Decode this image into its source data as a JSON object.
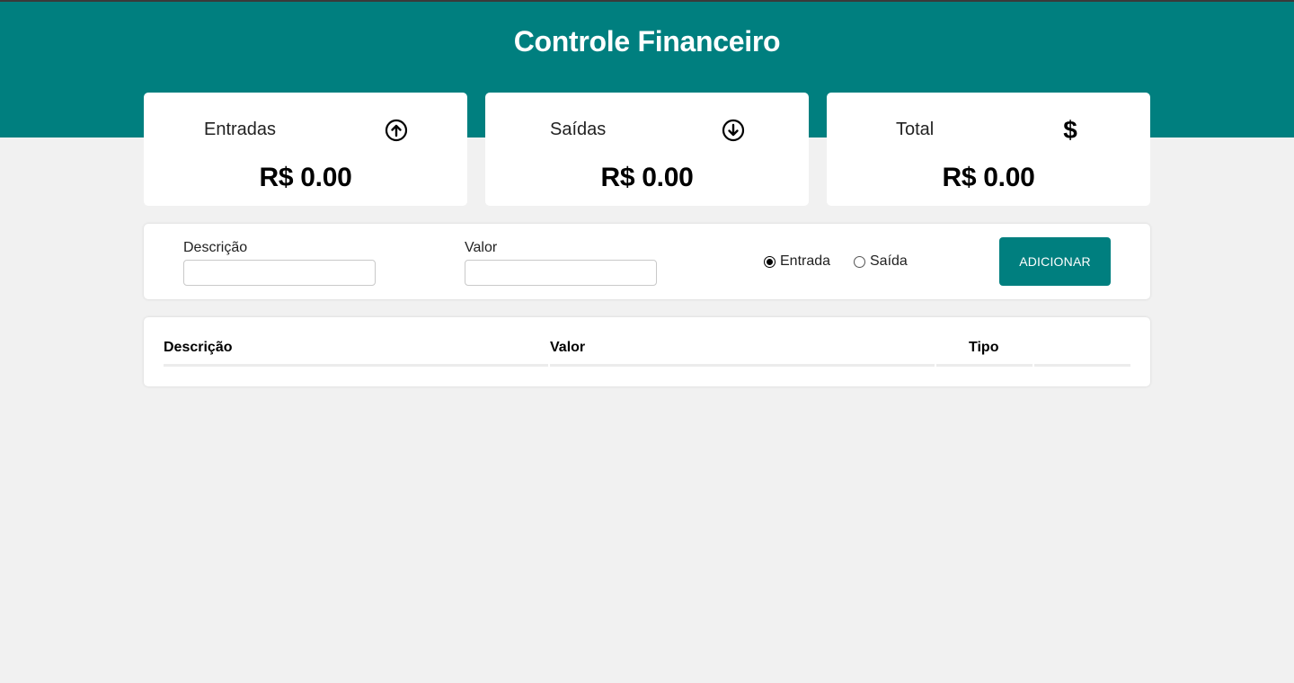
{
  "header": {
    "title": "Controle Financeiro"
  },
  "cards": [
    {
      "label": "Entradas",
      "icon": "arrow-up-circle-icon",
      "value": "R$ 0.00"
    },
    {
      "label": "Saídas",
      "icon": "arrow-down-circle-icon",
      "value": "R$ 0.00"
    },
    {
      "label": "Total",
      "icon": "dollar-sign-icon",
      "icon_text": "$",
      "value": "R$ 0.00"
    }
  ],
  "form": {
    "description_label": "Descrição",
    "description_value": "",
    "value_label": "Valor",
    "value_value": "",
    "radio_options": [
      {
        "label": "Entrada",
        "checked": true
      },
      {
        "label": "Saída",
        "checked": false
      }
    ],
    "add_button_label": "ADICIONAR"
  },
  "table": {
    "columns": [
      "Descrição",
      "Valor",
      "Tipo",
      ""
    ],
    "rows": []
  },
  "colors": {
    "header_bg": "#007f7f",
    "page_bg": "#f1f1f1",
    "button_bg": "#007f7f"
  }
}
